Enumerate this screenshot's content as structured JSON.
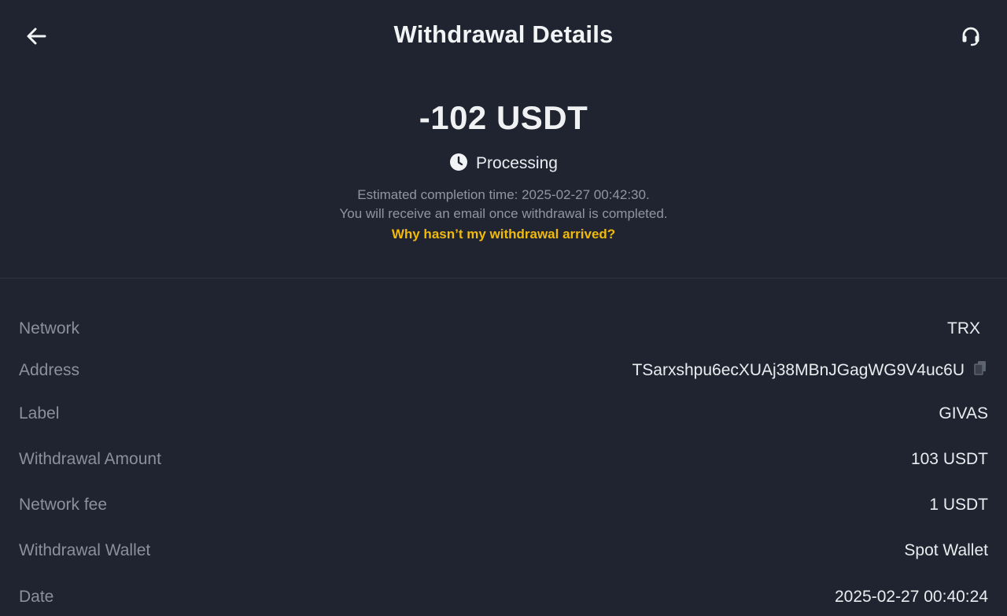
{
  "header": {
    "title": "Withdrawal Details",
    "back_icon": "arrow-left-icon",
    "support_icon": "headset-icon"
  },
  "summary": {
    "amount": "-102 USDT",
    "status": "Processing",
    "status_icon": "clock-icon",
    "estimate_line": "Estimated completion time: 2025-02-27 00:42:30.",
    "email_line": "You will receive an email once withdrawal is completed.",
    "help_link": "Why hasn’t my withdrawal arrived?"
  },
  "details": {
    "network": {
      "label": "Network",
      "value": "TRX"
    },
    "address": {
      "label": "Address",
      "value": "TSarxshpu6ecXUAj38MBnJGagWG9V4uc6U"
    },
    "label": {
      "label": "Label",
      "value": "GIVAS"
    },
    "withdrawal_amount": {
      "label": "Withdrawal Amount",
      "value": "103 USDT"
    },
    "network_fee": {
      "label": "Network fee",
      "value": "1 USDT"
    },
    "withdrawal_wallet": {
      "label": "Withdrawal Wallet",
      "value": "Spot Wallet"
    },
    "date": {
      "label": "Date",
      "value": "2025-02-27 00:40:24"
    }
  },
  "colors": {
    "background": "#1f2430",
    "accent": "#f0b90b",
    "label": "#8a909c",
    "text": "#eaecef"
  }
}
